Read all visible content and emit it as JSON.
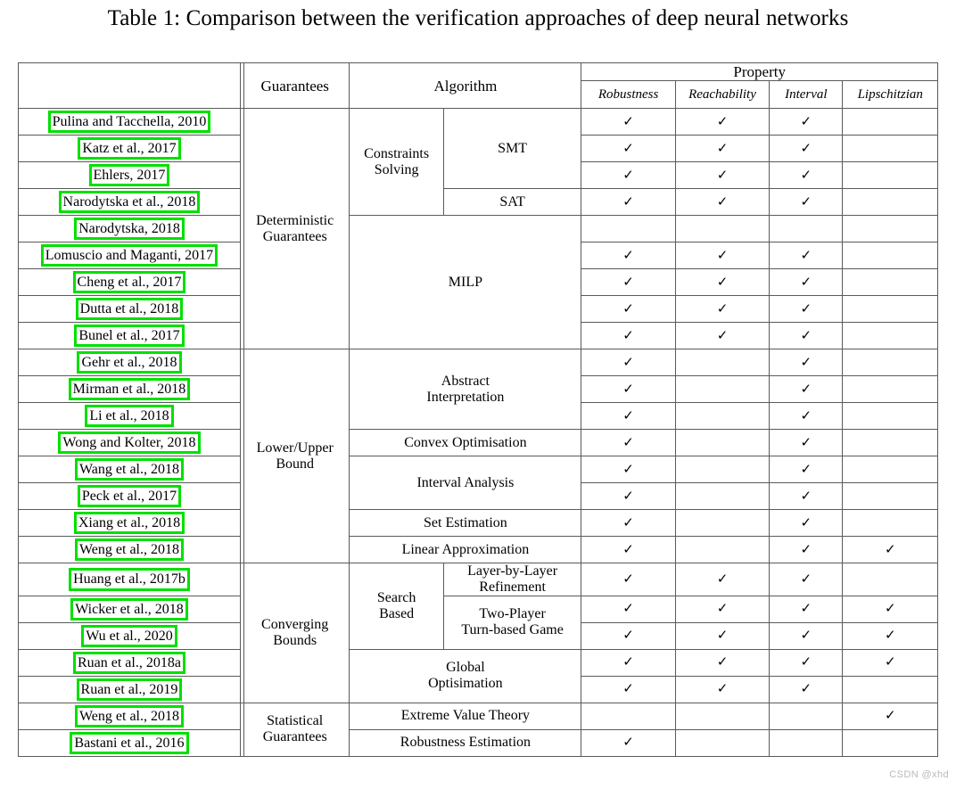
{
  "caption": "Table 1: Comparison between the verification approaches of deep neural networks",
  "watermark": "CSDN @xhd",
  "accent_green": "#00e000",
  "header": {
    "ref_col": "",
    "guarantees": "Guarantees",
    "algorithm": "Algorithm",
    "property": "Property",
    "property_sub": [
      "Robustness",
      "Reachability",
      "Interval",
      "Lipschitzian"
    ]
  },
  "check_glyph": "✓",
  "sections": [
    {
      "guarantee": "Deterministic\nGuarantees",
      "algo_groups": [
        {
          "label": "Constraints\nSolving",
          "rowspan": 4
        },
        {
          "label": "",
          "rowspan": 4
        }
      ],
      "subalgos": [
        {
          "label": "SMT",
          "rowspan": 3
        },
        {
          "label": "SAT",
          "rowspan": 1
        },
        {
          "label": "MILP",
          "rowspan": 4,
          "fullspan": true
        }
      ],
      "rows": [
        {
          "ref": "Pulina and Tacchella, 2010",
          "props": [
            true,
            true,
            true,
            false
          ]
        },
        {
          "ref": "Katz et al., 2017",
          "props": [
            true,
            true,
            true,
            false
          ]
        },
        {
          "ref": "Ehlers, 2017",
          "props": [
            true,
            true,
            true,
            false
          ]
        },
        {
          "ref": "Narodytska et al., 2018",
          "props": [
            true,
            true,
            true,
            false
          ]
        },
        {
          "ref": "Narodytska, 2018",
          "props": [
            true,
            true,
            true,
            false
          ]
        },
        {
          "ref": "Lomuscio and Maganti, 2017",
          "props": [
            true,
            true,
            true,
            false
          ]
        },
        {
          "ref": "Cheng et al., 2017",
          "props": [
            true,
            true,
            true,
            false
          ]
        },
        {
          "ref": "Dutta et al., 2018",
          "props": [
            true,
            true,
            true,
            false
          ]
        },
        {
          "ref": "Bunel et al., 2017",
          "props": [
            true,
            true,
            true,
            false
          ]
        }
      ]
    },
    {
      "guarantee": "Lower/Upper\nBound",
      "subalgos": [
        {
          "label": "Abstract\nInterpretation",
          "rowspan": 3
        },
        {
          "label": "Convex Optimisation",
          "rowspan": 1
        },
        {
          "label": "Interval Analysis",
          "rowspan": 2
        },
        {
          "label": "Set Estimation",
          "rowspan": 1
        },
        {
          "label": "Linear Approximation",
          "rowspan": 1
        }
      ],
      "rows": [
        {
          "ref": "Gehr et al., 2018",
          "props": [
            true,
            false,
            true,
            false
          ]
        },
        {
          "ref": "Mirman et al., 2018",
          "props": [
            true,
            false,
            true,
            false
          ]
        },
        {
          "ref": "Li et al., 2018",
          "props": [
            true,
            false,
            true,
            false
          ]
        },
        {
          "ref": "Wong and Kolter, 2018",
          "props": [
            true,
            false,
            true,
            false
          ]
        },
        {
          "ref": "Wang et al., 2018",
          "props": [
            true,
            false,
            true,
            false
          ]
        },
        {
          "ref": "Peck et al., 2017",
          "props": [
            true,
            false,
            true,
            false
          ]
        },
        {
          "ref": "Xiang et al., 2018",
          "props": [
            true,
            false,
            true,
            false
          ]
        },
        {
          "ref": "Weng et al., 2018",
          "props": [
            true,
            false,
            true,
            true
          ]
        }
      ]
    },
    {
      "guarantee": "Converging\nBounds",
      "algo_groups": [
        {
          "label": "Search\nBased",
          "rowspan": 3
        }
      ],
      "subalgos": [
        {
          "label": "Layer-by-Layer\nRefinement",
          "rowspan": 1
        },
        {
          "label": "Two-Player\nTurn-based Game",
          "rowspan": 2
        },
        {
          "label": "Global\nOptisimation",
          "rowspan": 2,
          "fullspan": true
        }
      ],
      "rows": [
        {
          "ref": "Huang et al., 2017b",
          "props": [
            true,
            true,
            true,
            false
          ]
        },
        {
          "ref": "Wicker et al., 2018",
          "props": [
            true,
            true,
            true,
            true
          ]
        },
        {
          "ref": "Wu et al., 2020",
          "props": [
            true,
            true,
            true,
            true
          ]
        },
        {
          "ref": "Ruan et al., 2018a",
          "props": [
            true,
            true,
            true,
            true
          ]
        },
        {
          "ref": "Ruan et al., 2019",
          "props": [
            true,
            true,
            true,
            false
          ]
        }
      ]
    },
    {
      "guarantee": "Statistical\nGuarantees",
      "subalgos": [
        {
          "label": "Extreme Value Theory",
          "rowspan": 1
        },
        {
          "label": "Robustness Estimation",
          "rowspan": 1
        }
      ],
      "rows": [
        {
          "ref": "Weng et al., 2018",
          "props": [
            false,
            false,
            false,
            true
          ]
        },
        {
          "ref": "Bastani et al., 2016",
          "props": [
            true,
            false,
            false,
            false
          ]
        }
      ]
    }
  ]
}
